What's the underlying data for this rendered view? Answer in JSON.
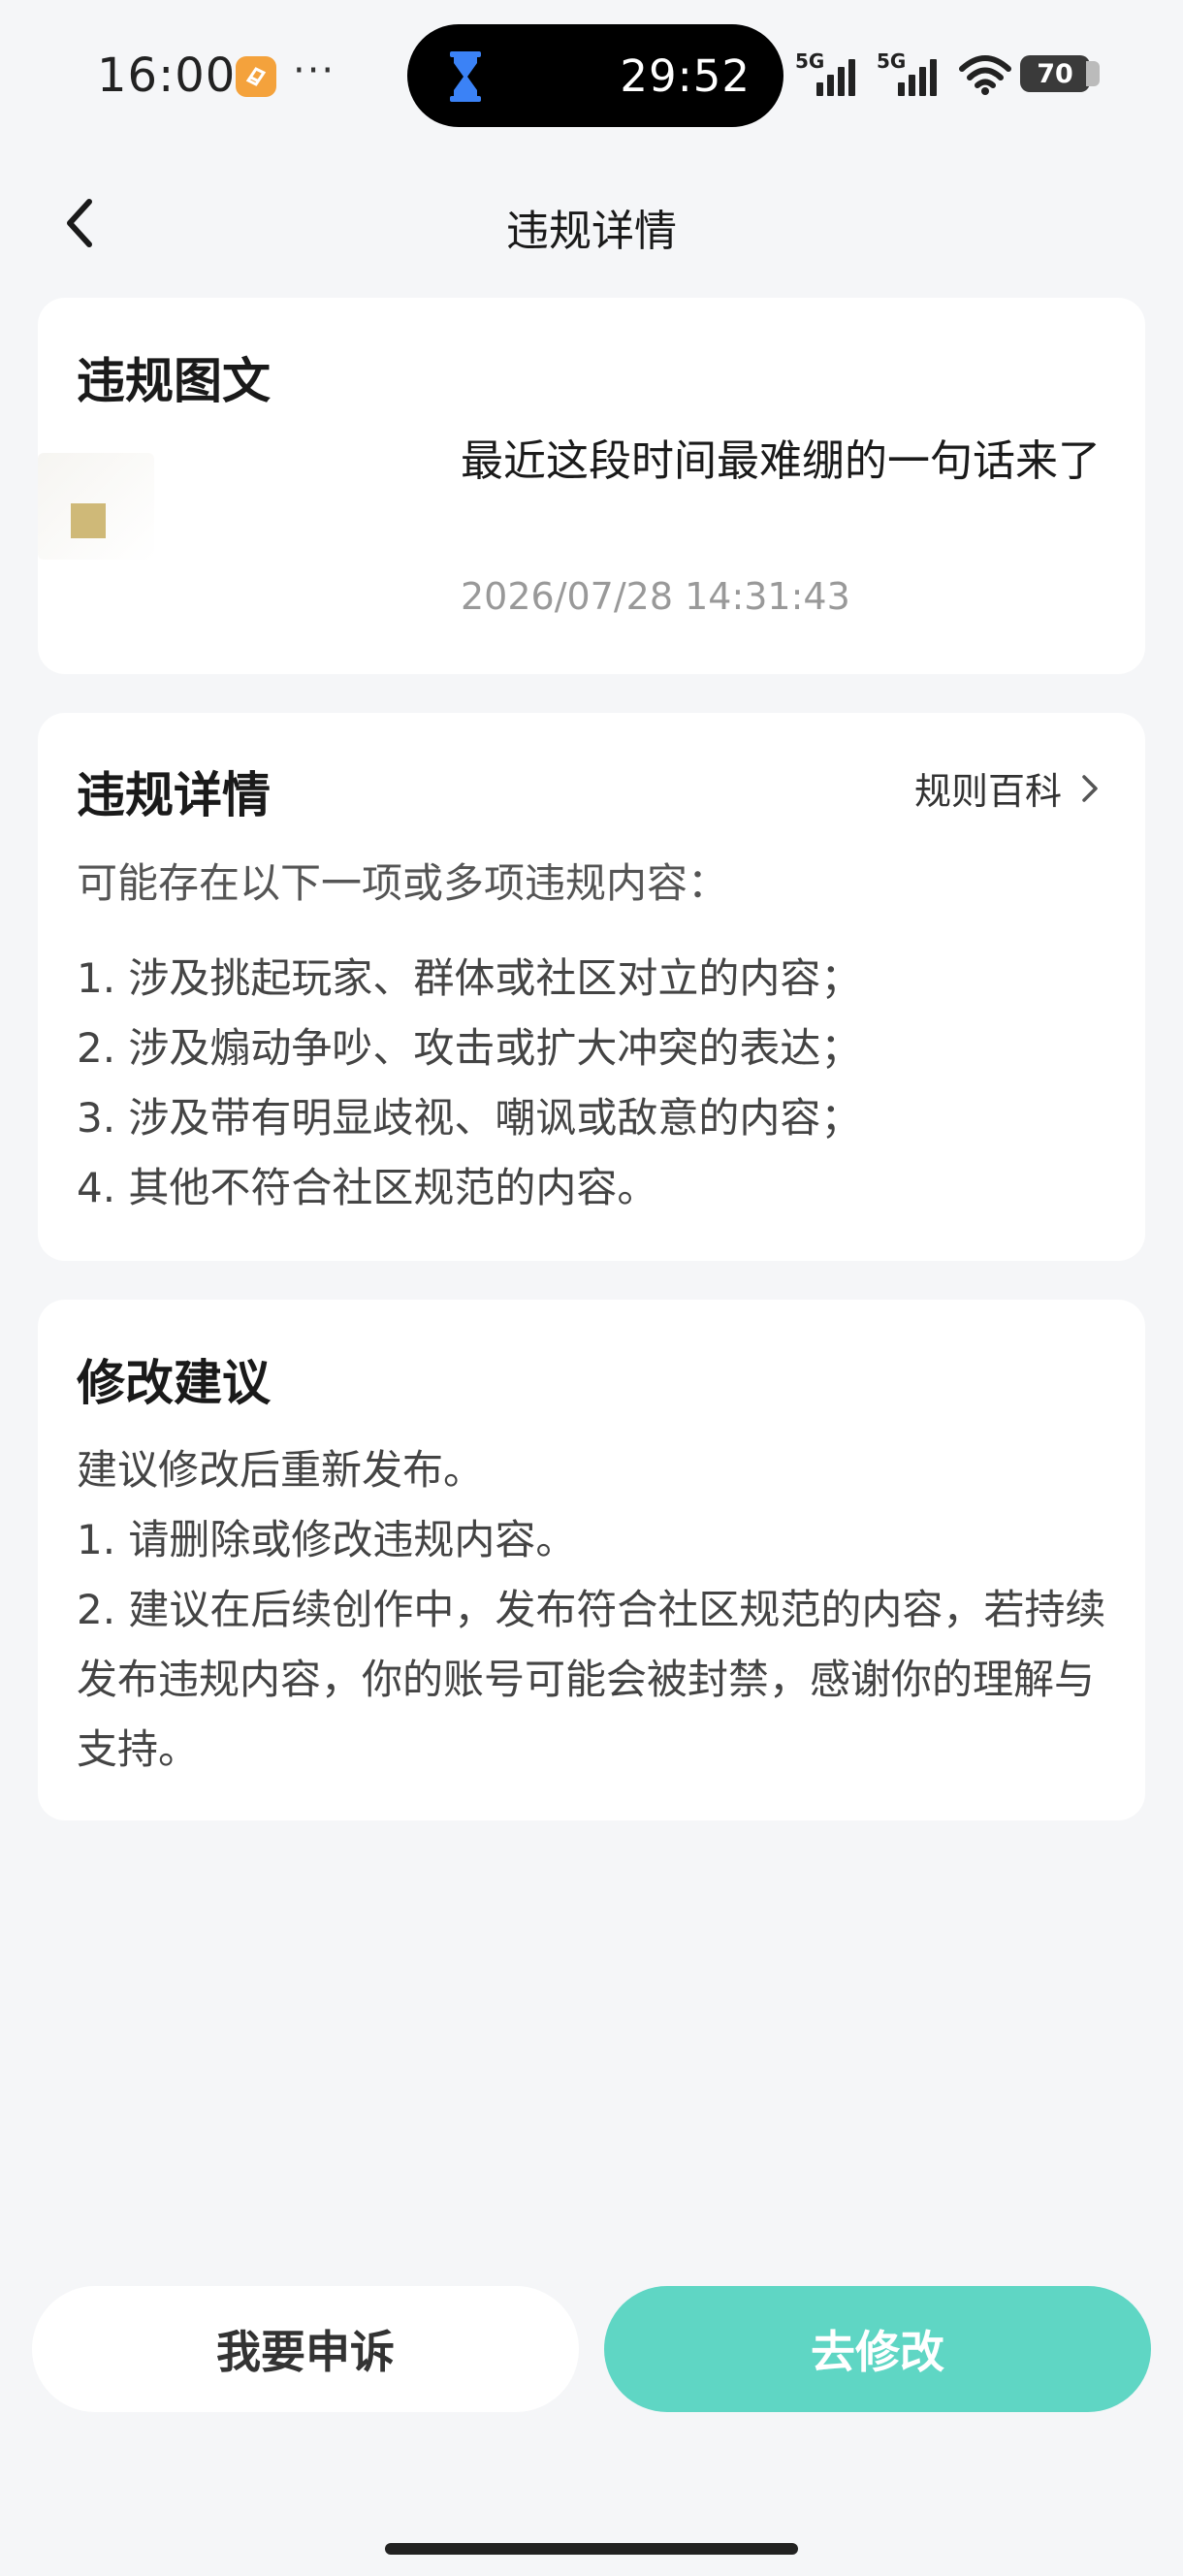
{
  "status_bar": {
    "time": "16:00",
    "more": "···",
    "timer": "29:52",
    "network_1": "5G",
    "network_2": "5G",
    "battery": "70"
  },
  "header": {
    "title": "违规详情"
  },
  "post_card": {
    "heading": "违规图文",
    "post_title": "最近这段时间最难绷的一句话来了",
    "post_time": "2026/07/28 14:31:43"
  },
  "details_card": {
    "heading": "违规详情",
    "rules_link": "规则百科",
    "intro": "可能存在以下一项或多项违规内容：",
    "items": [
      "1. 涉及挑起玩家、群体或社区对立的内容；",
      "2. 涉及煽动争吵、攻击或扩大冲突的表达；",
      "3. 涉及带有明显歧视、嘲讽或敌意的内容；",
      "4. 其他不符合社区规范的内容。"
    ]
  },
  "suggest_card": {
    "heading": "修改建议",
    "lines": [
      "建议修改后重新发布。",
      "1. 请删除或修改违规内容。",
      "2. 建议在后续创作中，发布符合社区规范的内容，若持续发布违规内容，你的账号可能会被封禁，感谢你的理解与支持。"
    ]
  },
  "actions": {
    "appeal": "我要申诉",
    "edit": "去修改"
  },
  "colors": {
    "accent": "#5fd6c4",
    "background": "#f5f6f8"
  }
}
